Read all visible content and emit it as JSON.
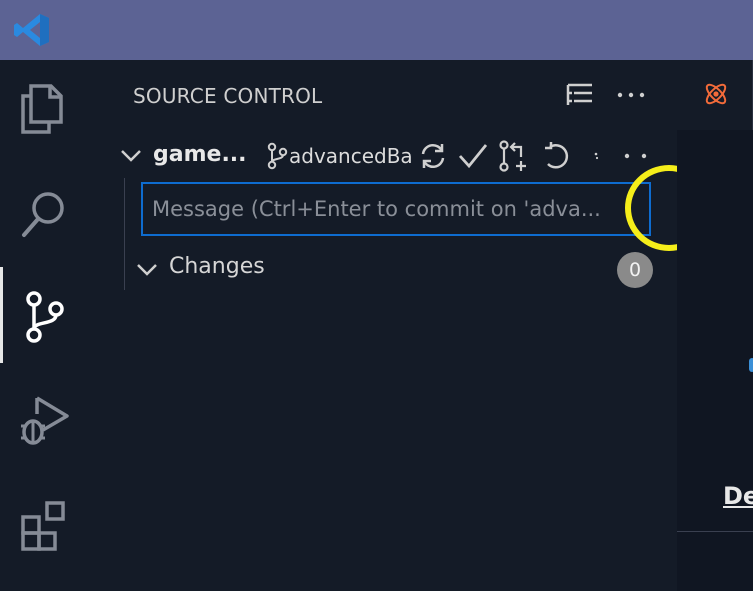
{
  "sidebar": {
    "title": "SOURCE CONTROL"
  },
  "repo": {
    "name": "game...",
    "branch": "advancedBa"
  },
  "commit": {
    "placeholder": "Message (Ctrl+Enter to commit on 'adva..."
  },
  "changes": {
    "label": "Changes",
    "count": "0"
  },
  "editor": {
    "partial_text": "De"
  },
  "colors": {
    "titlebar": "#5c6394",
    "background": "#141b27",
    "focus_border": "#0e6ccf",
    "highlight": "#f5ee1a",
    "badge": "#8a8a8a"
  },
  "icons": [
    "vscode-logo-icon",
    "explorer-icon",
    "search-icon",
    "source-control-icon",
    "run-debug-icon",
    "extensions-icon",
    "view-as-tree-icon",
    "more-actions-icon",
    "chevron-down-icon",
    "branch-icon",
    "sync-icon",
    "commit-check-icon",
    "pull-request-icon",
    "refresh-icon",
    "more-icon"
  ]
}
